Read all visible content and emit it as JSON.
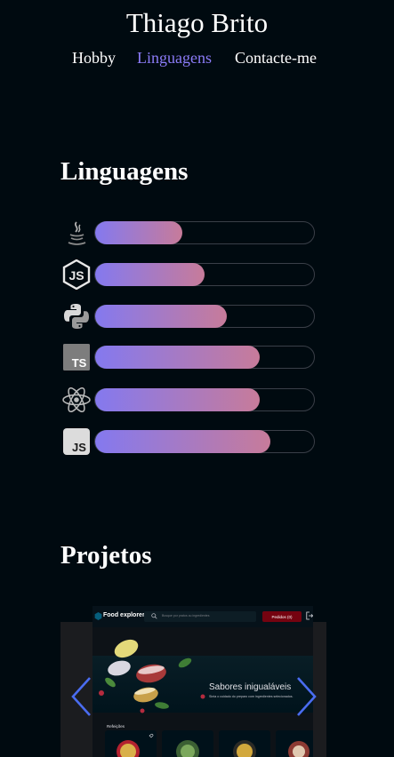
{
  "header": {
    "title": "Thiago Brito",
    "nav": [
      {
        "label": "Hobby",
        "active": false
      },
      {
        "label": "Linguagens",
        "active": true
      },
      {
        "label": "Contacte-me",
        "active": false
      }
    ]
  },
  "languages": {
    "title": "Linguagens",
    "skills": [
      {
        "name": "java-icon",
        "level": 0.4
      },
      {
        "name": "nodejs-icon",
        "level": 0.5
      },
      {
        "name": "python-icon",
        "level": 0.6
      },
      {
        "name": "typescript-icon",
        "level": 0.75
      },
      {
        "name": "react-icon",
        "level": 0.75
      },
      {
        "name": "javascript-icon",
        "level": 0.8
      }
    ]
  },
  "projects": {
    "title": "Projetos",
    "slide": {
      "brand": "Food explorer",
      "search_placeholder": "Busque por pratos ou ingredientes",
      "order_button": "Pedidos (0)",
      "banner_title": "Sabores inigualáveis",
      "banner_subtitle": "Sinta o cuidado do preparo com ingredientes selecionados.",
      "section_label": "Refeições"
    }
  },
  "colors": {
    "background": "#000a10",
    "accent": "#8b7cf8",
    "gradient_start": "#8479ef",
    "gradient_end": "#c77b9a",
    "arrow": "#4a6cf0"
  }
}
